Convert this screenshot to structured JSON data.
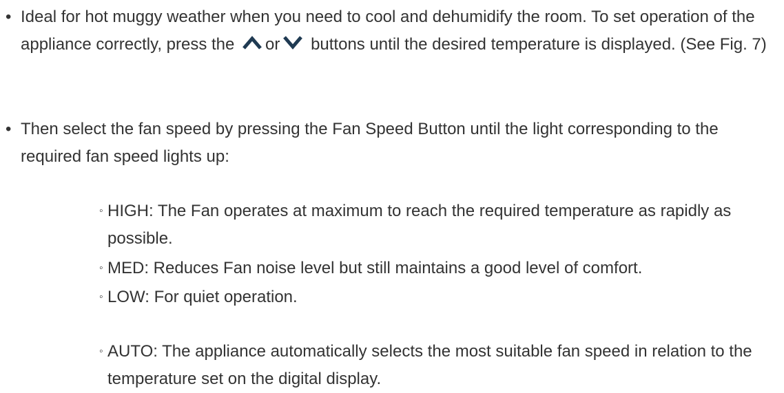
{
  "bullets": [
    {
      "text_before": "Ideal for hot muggy weather when you need to cool and dehumidify the room. To set operation of the appliance correctly, press the",
      "or_text": "or",
      "text_after": "buttons until the desired temperature is displayed. (See Fig. 7)"
    },
    {
      "text": "Then select the fan speed by pressing the Fan Speed Button until the light corresponding to the required fan speed lights up:"
    }
  ],
  "fan_speeds": [
    {
      "text": "HIGH: The Fan operates at maximum to reach the required temperature as rapidly as possible."
    },
    {
      "text": "MED: Reduces Fan noise level but still maintains a good level of comfort."
    },
    {
      "text": "LOW: For quiet operation."
    },
    {
      "text": "AUTO: The appliance automatically selects the most suitable fan speed in relation to the temperature set on the digital display."
    }
  ],
  "markers": {
    "bullet": "•",
    "sub_bullet": "◦"
  },
  "icons": {
    "up": "chevron-up-icon",
    "down": "chevron-down-icon"
  },
  "colors": {
    "text": "#333333",
    "icon": "#1f3a52"
  }
}
